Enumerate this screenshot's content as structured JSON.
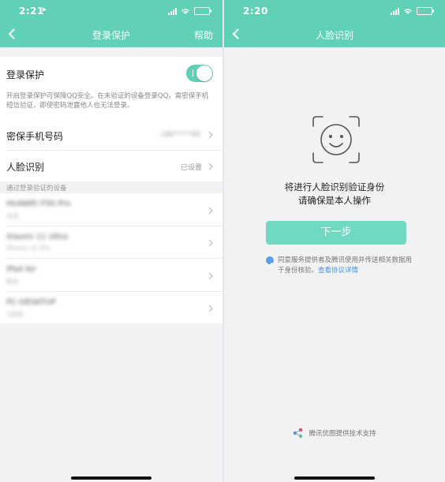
{
  "left": {
    "status": {
      "time": "2:21"
    },
    "nav": {
      "title": "登录保护",
      "help": "帮助"
    },
    "login_protect": {
      "label": "登录保护",
      "enabled": true,
      "description": "开启登录保护可保障QQ安全。在未验证的设备登录QQ，需密保手机短信验证，即使密码泄露他人也无法登录。"
    },
    "phone_row": {
      "label": "密保手机号码",
      "value": "186*****88"
    },
    "face_row": {
      "label": "人脸识别",
      "value": "已设置"
    },
    "devices_section": "通过登录验证的设备",
    "devices": [
      {
        "name": "HUAWEI P30 Pro",
        "detail": "今天"
      },
      {
        "name": "Xiaomi 11 Ultra",
        "detail": "iPhone 11 Pro"
      },
      {
        "name": "iPad Air",
        "detail": "昨天"
      },
      {
        "name": "PC-DESKTOP",
        "detail": "1天前"
      }
    ]
  },
  "right": {
    "status": {
      "time": "2:20"
    },
    "nav": {
      "title": "人脸识别"
    },
    "prompt_line1": "将进行人脸识别验证身份",
    "prompt_line2": "请确保是本人操作",
    "next_button": "下一步",
    "agreement_text": "同意服务提供者及腾讯使用并传送相关数据用于身份核验。",
    "agreement_link": "查看协议详情",
    "footer": "腾讯优图提供技术支持"
  },
  "colors": {
    "accent": "#60d1b6",
    "button": "#71d8c1",
    "link": "#4a90e2"
  }
}
